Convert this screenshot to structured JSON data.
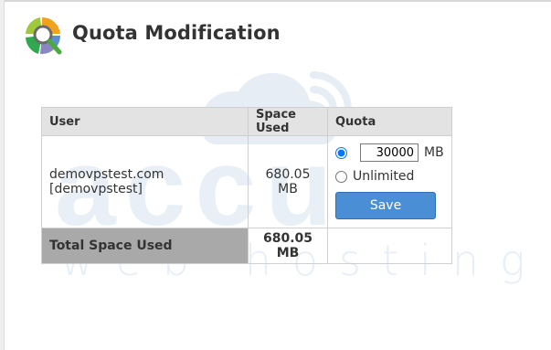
{
  "page": {
    "title": "Quota Modification",
    "icon": "quota-pie-magnifier-icon"
  },
  "table": {
    "headers": {
      "user": "User",
      "space_used": "Space Used",
      "quota": "Quota"
    },
    "rows": [
      {
        "user": "demovpstest.com [demovpstest]",
        "space_used": "680.05 MB",
        "quota": {
          "mode": "limited",
          "value": "30000",
          "unit": "MB",
          "unlimited_label": "Unlimited",
          "save_label": "Save"
        }
      }
    ],
    "total": {
      "label": "Total Space Used",
      "value": "680.05 MB"
    }
  },
  "watermark": {
    "text": "accu",
    "subtext": "web hosting"
  },
  "colors": {
    "save_button": "#4a8fd6",
    "header_bg": "#e3e3e3",
    "total_label_bg": "#a9a9a9",
    "watermark": "#e7eef5"
  }
}
